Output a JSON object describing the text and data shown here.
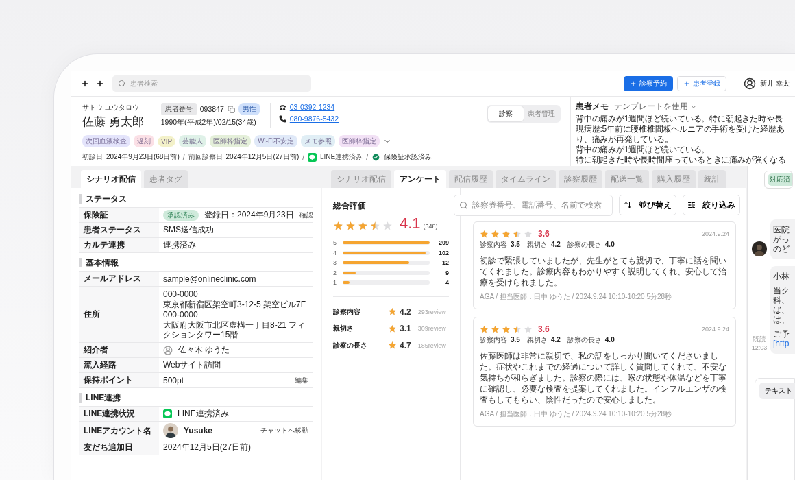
{
  "search": {
    "placeholder": "患者検索"
  },
  "actions": [
    {
      "label": "診察予約",
      "kind": "primary"
    },
    {
      "label": "患者登録",
      "kind": "secondary"
    }
  ],
  "user": {
    "name": "新井 幸太"
  },
  "patient": {
    "kana": "サトウ ユウタロウ",
    "name": "佐藤 勇太郎",
    "id_label": "患者番号",
    "id": "093847",
    "gender": "男性",
    "birth": "1990年(平成2年)/02/15(34歳)",
    "phones": [
      {
        "kind": "landline",
        "number": "03-0392-1234"
      },
      {
        "kind": "mobile",
        "number": "080-9876-5432"
      }
    ],
    "tags": [
      {
        "label": "次回血液検査",
        "color": "#e4e4fb"
      },
      {
        "label": "遅刻",
        "color": "#fbe0e6"
      },
      {
        "label": "VIP",
        "color": "#f3f1c9"
      },
      {
        "label": "芸能人",
        "color": "#dff1e8"
      },
      {
        "label": "医師枠指定",
        "color": "#e4efd9"
      },
      {
        "label": "Wi-Fi不安定",
        "color": "#e0e9f8"
      },
      {
        "label": "メモ参照",
        "color": "#e0eef5"
      },
      {
        "label": "医師枠指定",
        "color": "#f2e1f5"
      }
    ],
    "first_visit_label": "初診日",
    "first_visit": "2024年9月23日(68日前)",
    "last_visit_label": "前回診察日",
    "last_visit": "2024年12月5日(27日前)",
    "line_status": "LINE連携済み",
    "insurance_status": "保険証承認済み",
    "separator": "/"
  },
  "mode_toggle": [
    {
      "label": "診察",
      "selected": true
    },
    {
      "label": "患者管理",
      "selected": false
    }
  ],
  "memo": {
    "title": "患者メモ",
    "template": "テンプレートを使用",
    "lines": [
      "背中の痛みが1週間ほど続いている。特に朝起きた時や長",
      "現病歴:5年前に腰椎椎間板ヘルニアの手術を受けた経歴あ",
      "り、痛みが再発している。",
      "背中の痛みが1週間ほど続いている。",
      "特に朝起きた時や長時間座っているときに痛みが強くなる"
    ]
  },
  "left_tabs": [
    {
      "label": "シナリオ配信",
      "selected": true
    },
    {
      "label": "患者タグ",
      "selected": false
    }
  ],
  "sections": [
    {
      "title": "ステータス",
      "rows": [
        {
          "kind": "badge",
          "label": "保険証",
          "badge": "承認済み",
          "value": "登録日：2024年9月23日",
          "action": "確認"
        },
        {
          "kind": "text",
          "label": "患者ステータス",
          "value": "SMS送信成功"
        },
        {
          "kind": "text",
          "label": "カルテ連携",
          "value": "連携済み"
        }
      ]
    },
    {
      "title": "基本情報",
      "rows": [
        {
          "kind": "text",
          "label": "メールアドレス",
          "value": "sample@onlineclinic.com"
        },
        {
          "kind": "address",
          "label": "住所",
          "addresses": [
            {
              "zip": "000-0000",
              "line": "東京都新宿区架空町3-12-5 架空ビル7F"
            },
            {
              "zip": "000-0000",
              "line": "大阪府大阪市北区虚構一丁目8-21 フィクションタワー15階"
            }
          ]
        },
        {
          "kind": "person",
          "label": "紹介者",
          "value": "佐々木 ゆうた"
        },
        {
          "kind": "text",
          "label": "流入経路",
          "value": "Webサイト訪問"
        },
        {
          "kind": "text",
          "label": "保持ポイント",
          "value": "500pt",
          "action": "編集"
        }
      ]
    },
    {
      "title": "LINE連携",
      "rows": [
        {
          "kind": "line",
          "label": "LINE連携状況",
          "value": "LINE連携済み"
        },
        {
          "kind": "account",
          "label": "LINEアカウント名",
          "value": "Yusuke",
          "action": "チャットへ移動"
        },
        {
          "kind": "text",
          "label": "友だち追加日",
          "value": "2024年12月5日(27日前)"
        }
      ]
    }
  ],
  "main_tabs": [
    {
      "label": "シナリオ配信",
      "selected": false
    },
    {
      "label": "アンケート",
      "selected": true
    },
    {
      "label": "配信履歴",
      "selected": false
    },
    {
      "label": "タイムライン",
      "selected": false
    },
    {
      "label": "診察履歴",
      "selected": false
    },
    {
      "label": "配送一覧",
      "selected": false
    },
    {
      "label": "購入履歴",
      "selected": false
    },
    {
      "label": "統計",
      "selected": false
    }
  ],
  "rating": {
    "title": "総合評価",
    "stars": 3.5,
    "score": "4.1",
    "count": "(348)",
    "distribution": [
      {
        "label": "5",
        "level": 1,
        "count": "209"
      },
      {
        "label": "4",
        "level": 0.95,
        "count": "102"
      },
      {
        "label": "3",
        "level": 0.76,
        "count": "12"
      },
      {
        "label": "2",
        "level": 0.15,
        "count": "9"
      },
      {
        "label": "1",
        "level": 0.08,
        "count": "4"
      }
    ],
    "categories": [
      {
        "label": "診察内容",
        "score": "4.2",
        "reviews": "293review"
      },
      {
        "label": "親切さ",
        "score": "3.1",
        "reviews": "309review"
      },
      {
        "label": "診察の長さ",
        "score": "4.7",
        "reviews": "185review"
      }
    ]
  },
  "review_search": {
    "placeholder": "診察券番号、電話番号、名前で検索"
  },
  "review_actions": [
    {
      "label": "並び替え",
      "kind": "sort"
    },
    {
      "label": "絞り込み",
      "kind": "filter"
    }
  ],
  "reviews": [
    {
      "stars": 3.5,
      "score": "3.6",
      "date": "2024.9.24",
      "subscores": [
        {
          "label": "診察内容",
          "value": "3.5"
        },
        {
          "label": "親切さ",
          "value": "4.2"
        },
        {
          "label": "診察の長さ",
          "value": "4.0"
        }
      ],
      "body": "初診で緊張していましたが、先生がとても親切で、丁寧に話を聞いてくれました。診療内容もわかりやすく説明してくれ、安心して治療を受けられました。",
      "meta": "AGA / 担当医師：田中 ゆうた / 2024.9.24 10:10-10:20 5分28秒"
    },
    {
      "stars": 3.5,
      "score": "3.6",
      "date": "2024.9.24",
      "subscores": [
        {
          "label": "診察内容",
          "value": "3.5"
        },
        {
          "label": "親切さ",
          "value": "4.2"
        },
        {
          "label": "診察の長さ",
          "value": "4.0"
        }
      ],
      "body": "佐藤医師は非常に親切で、私の話をしっかり聞いてくださいました。症状やこれまでの経過について詳しく質問してくれて、不安な気持ちが和らぎました。診察の際には、喉の状態や体温などを丁寧に確認し、必要な検査を提案してくれました。インフルエンザの検査もしてもらい、陰性だったので安心しました。",
      "meta": "AGA / 担当医師：田中 ゆうた / 2024.9.24 10:10-10:20 5分28秒"
    }
  ],
  "chat": {
    "status": "対応済",
    "messages": [
      {
        "kind": "incoming",
        "paragraphs": [
          {
            "lines": [
              "医院",
              "がっ",
              "のど"
            ]
          }
        ]
      },
      {
        "kind": "outgoing",
        "read": "既読",
        "time": "12:03",
        "paragraphs": [
          {
            "lines": [
              "小林"
            ]
          },
          {
            "lines": [
              "当ク",
              "科、",
              "ば、",
              "は、"
            ]
          },
          {
            "lines": [
              "ご予"
            ],
            "link": "[http"
          }
        ]
      }
    ],
    "compose_tab": "テキスト"
  }
}
